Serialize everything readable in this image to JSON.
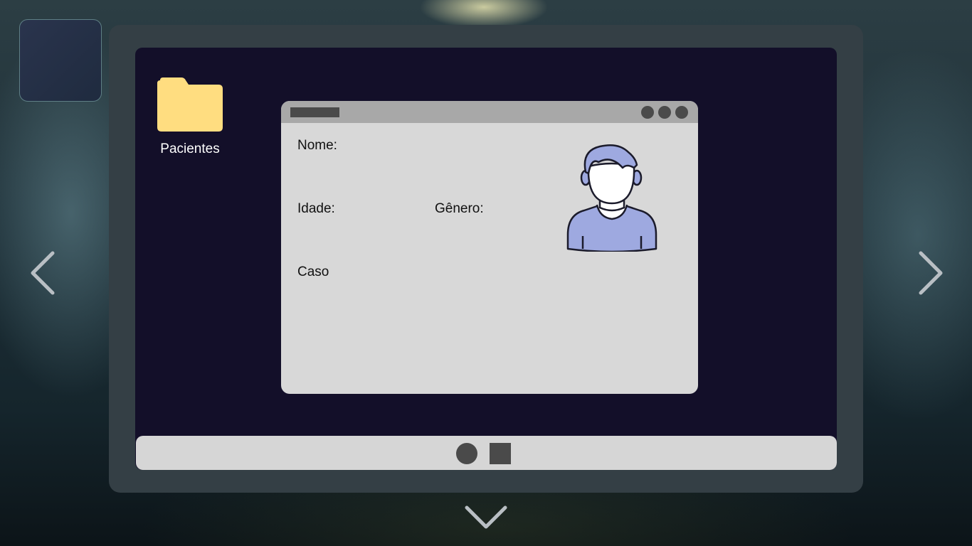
{
  "desktop": {
    "folder_label": "Pacientes",
    "folder_color": "#ffdd80"
  },
  "patient_window": {
    "fields": {
      "name_label": "Nome:",
      "age_label": "Idade:",
      "gender_label": "Gênero:",
      "case_label": "Caso"
    },
    "avatar_color": "#9ea9e0"
  },
  "taskbar": {
    "items": [
      "circle-app",
      "square-app"
    ]
  },
  "navigation": {
    "left": "chevron-left-icon",
    "right": "chevron-right-icon",
    "down": "chevron-down-icon"
  }
}
